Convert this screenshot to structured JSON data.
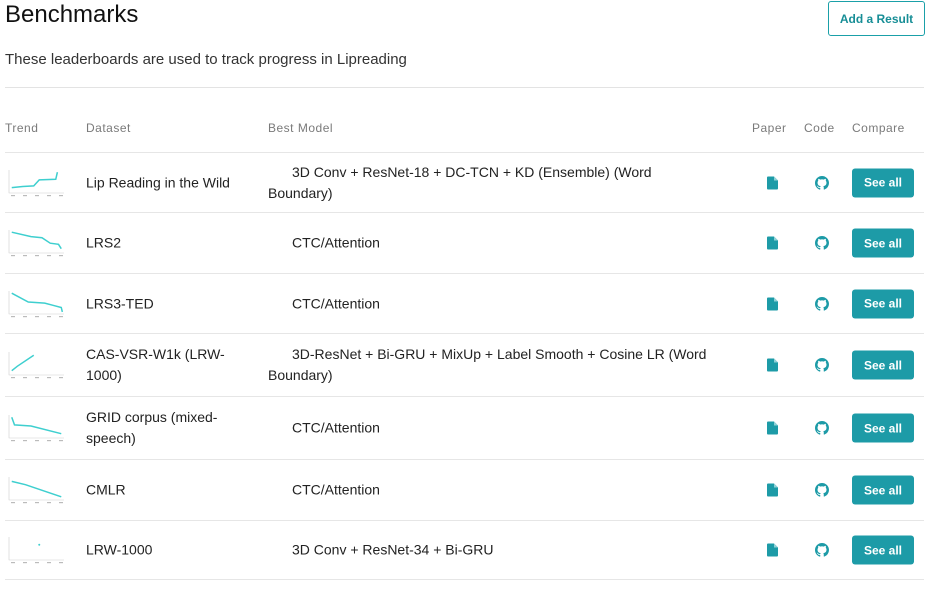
{
  "header": {
    "title": "Benchmarks",
    "add_button": "Add a Result",
    "subtitle": "These leaderboards are used to track progress in Lipreading"
  },
  "columns": {
    "trend": "Trend",
    "dataset": "Dataset",
    "best_model": "Best Model",
    "paper": "Paper",
    "code": "Code",
    "compare": "Compare"
  },
  "colors": {
    "accent": "#1d9ba7",
    "trend_line": "#3ecfcf"
  },
  "rows": [
    {
      "dataset": "Lip Reading in the Wild",
      "model": "3D Conv + ResNet-18 + DC-TCN + KD (Ensemble) (Word Boundary)",
      "paper_icon": "paper-icon",
      "code_icon": "github-icon",
      "compare": "See all",
      "trend": [
        [
          0.05,
          0.8
        ],
        [
          0.25,
          0.75
        ],
        [
          0.45,
          0.72
        ],
        [
          0.55,
          0.45
        ],
        [
          0.85,
          0.42
        ],
        [
          0.88,
          0.1
        ]
      ]
    },
    {
      "dataset": "LRS2",
      "model": "CTC/Attention",
      "paper_icon": "paper-icon",
      "code_icon": "github-icon",
      "compare": "See all",
      "trend": [
        [
          0.05,
          0.1
        ],
        [
          0.4,
          0.3
        ],
        [
          0.6,
          0.35
        ],
        [
          0.75,
          0.6
        ],
        [
          0.9,
          0.65
        ],
        [
          0.95,
          0.85
        ]
      ]
    },
    {
      "dataset": "LRS3-TED",
      "model": "CTC/Attention",
      "paper_icon": "paper-icon",
      "code_icon": "github-icon",
      "compare": "See all",
      "trend": [
        [
          0.05,
          0.1
        ],
        [
          0.35,
          0.5
        ],
        [
          0.65,
          0.55
        ],
        [
          0.8,
          0.65
        ],
        [
          0.95,
          0.75
        ],
        [
          0.97,
          0.95
        ]
      ]
    },
    {
      "dataset": "CAS-VSR-W1k (LRW-1000)",
      "model": "3D-ResNet + Bi-GRU + MixUp + Label Smooth + Cosine LR (Word Boundary)",
      "paper_icon": "paper-icon",
      "code_icon": "github-icon",
      "compare": "See all",
      "trend": [
        [
          0.05,
          0.85
        ],
        [
          0.15,
          0.65
        ],
        [
          0.45,
          0.15
        ]
      ]
    },
    {
      "dataset": "GRID corpus (mixed-speech)",
      "model": "CTC/Attention",
      "paper_icon": "paper-icon",
      "code_icon": "github-icon",
      "compare": "See all",
      "trend": [
        [
          0.05,
          0.1
        ],
        [
          0.1,
          0.45
        ],
        [
          0.4,
          0.5
        ],
        [
          0.95,
          0.85
        ]
      ]
    },
    {
      "dataset": "CMLR",
      "model": "CTC/Attention",
      "paper_icon": "paper-icon",
      "code_icon": "github-icon",
      "compare": "See all",
      "trend": [
        [
          0.05,
          0.2
        ],
        [
          0.3,
          0.35
        ],
        [
          0.95,
          0.9
        ]
      ]
    },
    {
      "dataset": "LRW-1000",
      "model": "3D Conv + ResNet-34 + Bi-GRU",
      "paper_icon": "paper-icon",
      "code_icon": "github-icon",
      "compare": "See all",
      "trend": [
        [
          0.55,
          0.35
        ]
      ]
    }
  ]
}
